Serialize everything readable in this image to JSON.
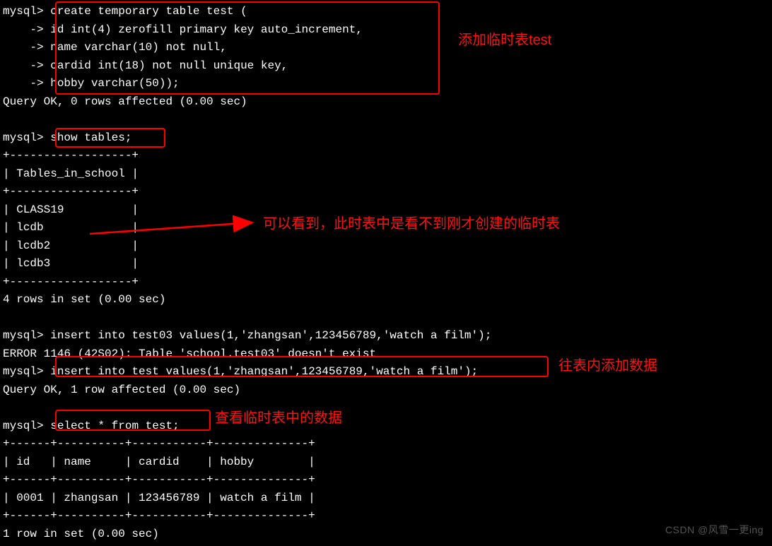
{
  "prompt": "mysql> ",
  "cont": "    -> ",
  "create": {
    "l1": "create temporary table test (",
    "l2": "id int(4) zerofill primary key auto_increment,",
    "l3": "name varchar(10) not null,",
    "l4": "cardid int(18) not null unique key,",
    "l5": "hobby varchar(50));"
  },
  "query_ok_0": "Query OK, 0 rows affected (0.00 sec)",
  "show_tables_cmd": "show tables;",
  "tables_border": "+------------------+",
  "tables_header": "| Tables_in_school |",
  "tables_rows": [
    "| CLASS19          |",
    "| lcdb             |",
    "| lcdb2            |",
    "| lcdb3            |"
  ],
  "rows_in_set_4": "4 rows in set (0.00 sec)",
  "insert_wrong": "insert into test03 values(1,'zhangsan',123456789,'watch a film');",
  "error_1146": "ERROR 1146 (42S02): Table 'school.test03' doesn't exist",
  "insert_ok": "insert into test values(1,'zhangsan',123456789,'watch a film');",
  "query_ok_1": "Query OK, 1 row affected (0.00 sec)",
  "select_cmd": "select * from test;",
  "result_border": "+------+----------+-----------+--------------+",
  "result_header": "| id   | name     | cardid    | hobby        |",
  "result_row": "| 0001 | zhangsan | 123456789 | watch a film |",
  "rows_in_set_1": "1 row in set (0.00 sec)",
  "anno": {
    "create": "添加临时表test",
    "show": "可以看到，此时表中是看不到刚才创建的临时表",
    "insert": "往表内添加数据",
    "select": "查看临时表中的数据"
  },
  "watermark": "CSDN @风雪一更ing",
  "chart_data": {
    "type": "table",
    "title": "select * from test;",
    "columns": [
      "id",
      "name",
      "cardid",
      "hobby"
    ],
    "rows": [
      [
        "0001",
        "zhangsan",
        123456789,
        "watch a film"
      ]
    ]
  }
}
